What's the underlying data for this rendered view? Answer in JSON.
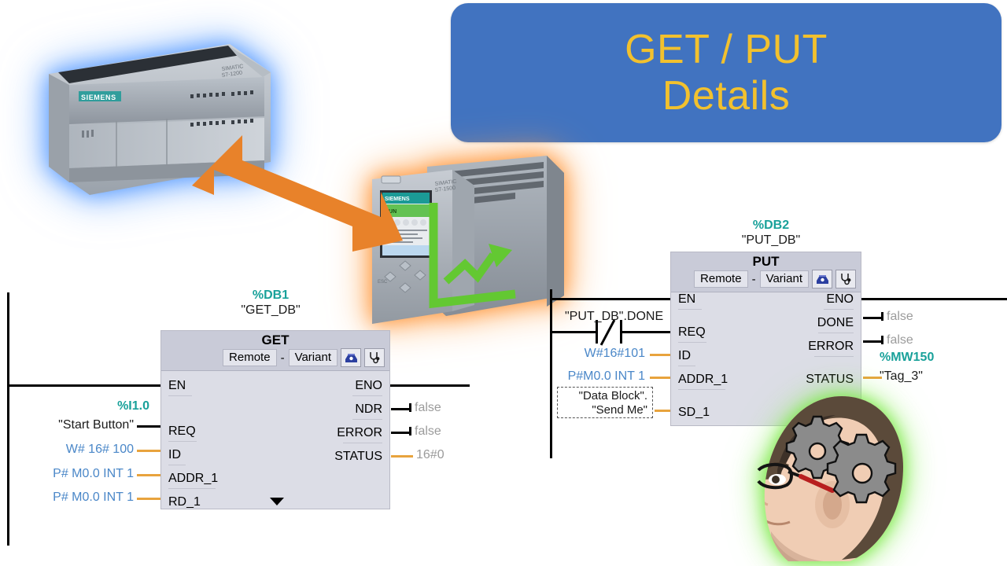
{
  "title_banner": {
    "line1": "GET / PUT",
    "line2": "Details",
    "bg_color": "#4173c0",
    "text_color": "#f2c12e"
  },
  "devices": {
    "left_plc": {
      "name": "SIMATIC S7-1200",
      "brand": "SIEMENS",
      "glow_color": "#5aa0ff"
    },
    "right_plc": {
      "name": "SIMATIC S7-1500",
      "brand": "SIEMENS",
      "glow_color": "#ff9a3c",
      "display_text": "RUN"
    },
    "link_arrow": {
      "label": "bidirectional-communication",
      "color": "#e8822a"
    },
    "avatar": {
      "label": "thinking-head-with-gears",
      "glow_color": "#7ae64a"
    }
  },
  "get_network": {
    "db_number": "%DB1",
    "db_name": "\"GET_DB\"",
    "block_title": "GET",
    "mode": "Remote",
    "separator": "-",
    "datatype": "Variant",
    "icons": [
      "connection-icon",
      "diagnostics-icon"
    ],
    "inputs": [
      {
        "pin": "EN",
        "tag": "",
        "value": "",
        "style": "power"
      },
      {
        "pin": "REQ",
        "tag": "\"Start Button\"",
        "address": "%I1.0",
        "style": "bool"
      },
      {
        "pin": "ID",
        "tag": "W# 16# 100",
        "style": "orange"
      },
      {
        "pin": "ADDR_1",
        "tag": "P# M0.0 INT 1",
        "style": "orange"
      },
      {
        "pin": "RD_1",
        "tag": "P# M0.0 INT 1",
        "style": "orange"
      }
    ],
    "outputs": [
      {
        "pin": "ENO",
        "value": "",
        "style": "power"
      },
      {
        "pin": "NDR",
        "value": "false",
        "style": "bool"
      },
      {
        "pin": "ERROR",
        "value": "false",
        "style": "bool"
      },
      {
        "pin": "STATUS",
        "value": "16#0",
        "style": "orange"
      }
    ],
    "expand_icon": "chevron-down-icon"
  },
  "put_network": {
    "db_number": "%DB2",
    "db_name": "\"PUT_DB\"",
    "block_title": "PUT",
    "mode": "Remote",
    "separator": "-",
    "datatype": "Variant",
    "icons": [
      "connection-icon",
      "diagnostics-icon"
    ],
    "contact": {
      "tag": "\"PUT_DB\".DONE",
      "type": "normally-closed-contact"
    },
    "inputs": [
      {
        "pin": "EN",
        "tag": "",
        "style": "power"
      },
      {
        "pin": "REQ",
        "tag": "",
        "style": "bool"
      },
      {
        "pin": "ID",
        "tag": "W#16#101",
        "style": "orange"
      },
      {
        "pin": "ADDR_1",
        "tag": "P#M0.0 INT 1",
        "style": "orange"
      },
      {
        "pin": "SD_1",
        "tag_line1": "\"Data Block\".",
        "tag_line2": "\"Send Me\"",
        "style": "orange-box"
      }
    ],
    "outputs": [
      {
        "pin": "ENO",
        "value": "",
        "style": "power"
      },
      {
        "pin": "DONE",
        "value": "false",
        "style": "bool"
      },
      {
        "pin": "ERROR",
        "value": "false",
        "style": "bool"
      },
      {
        "pin": "STATUS",
        "value": "\"Tag_3\"",
        "address": "%MW150",
        "style": "orange"
      }
    ]
  }
}
